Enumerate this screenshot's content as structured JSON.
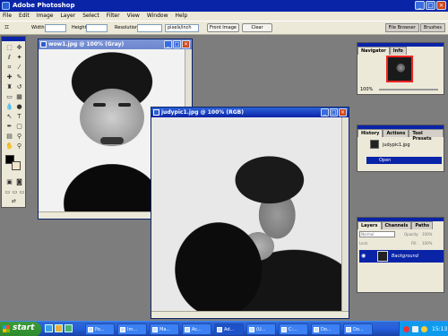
{
  "app": {
    "title": "Adobe Photoshop"
  },
  "menu": [
    "File",
    "Edit",
    "Image",
    "Layer",
    "Select",
    "Filter",
    "View",
    "Window",
    "Help"
  ],
  "options": {
    "width_label": "Width:",
    "height_label": "Height:",
    "resolution_label": "Resolution:",
    "units_value": "pixels/inch",
    "front_image": "Front Image",
    "clear": "Clear"
  },
  "wells": [
    "File Browser",
    "Brushes"
  ],
  "doc1": {
    "title": "wow1.jpg @ 100% (Gray)"
  },
  "doc2": {
    "title": "judypic1.jpg @ 100% (RGB)"
  },
  "navigator": {
    "tabs": [
      "Navigator",
      "Info"
    ],
    "zoom": "100%"
  },
  "history": {
    "tabs": [
      "History",
      "Actions",
      "Tool Presets"
    ],
    "snapshot": "judypic1.jpg",
    "state": "Open"
  },
  "layers": {
    "tabs": [
      "Layers",
      "Channels",
      "Paths"
    ],
    "blend_mode": "Normal",
    "opacity_label": "Opacity:",
    "opacity_value": "100%",
    "lock_label": "Lock:",
    "fill_label": "Fill:",
    "fill_value": "100%",
    "layer_name": "Background"
  },
  "taskbar": {
    "start": "start",
    "tasks": [
      "Po...",
      "Im...",
      "Ma...",
      "Ac...",
      "Ad...",
      "(U...",
      "C:...",
      "Do...",
      "Do..."
    ],
    "clock": "15:13"
  },
  "colors": {
    "titlebar": "#0a24a8",
    "taskbar": "#245edb",
    "start": "#2d8a2d",
    "highlight": "#0a24a8"
  }
}
